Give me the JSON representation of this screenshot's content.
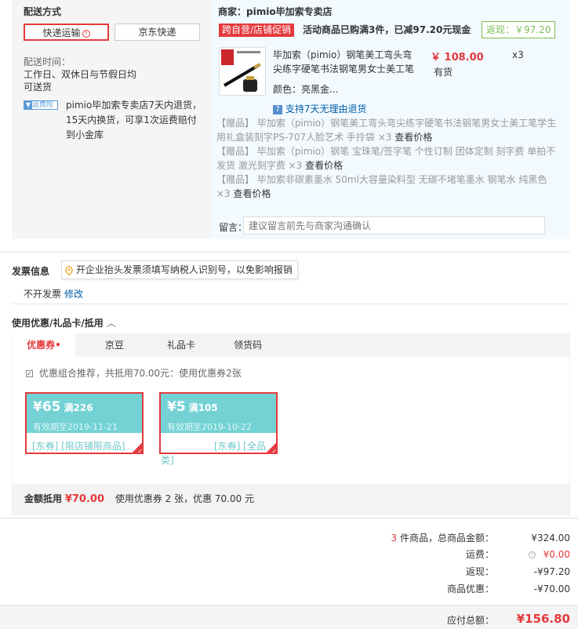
{
  "shipping": {
    "title": "配送方式",
    "option_express": "快递运输",
    "option_jd": "京东快递",
    "time_label": "配送时间：",
    "time_value": "工作日、双休日与节假日均",
    "time_value2": "可送货",
    "insurance_badge": "运费险",
    "insurance_l1": "pimio毕加索专卖店7天内退货，",
    "insurance_l2": "15天内换货，可享1次运费赔付",
    "insurance_l3": "到小金库"
  },
  "merchant": {
    "label": "商家：pimio毕加索专卖店",
    "promo_tag": "跨自营/店铺促销",
    "promo_text": "活动商品已购满3件，已减97.20元现金",
    "rebate": "返现：￥97.20"
  },
  "product": {
    "name_l1": "毕加索（pimio）钢笔美工弯头弯",
    "name_l2": "尖练字硬笔书法钢笔男女士美工笔",
    "price": "￥ 108.00",
    "qty": "x3",
    "stock": "有货",
    "color": "颜色：亮黑金...",
    "return_policy": "支持7天无理由退货"
  },
  "gifts": [
    {
      "l1": "【赠品】  毕加索（pimio）钢笔美工弯头弯尖练字硬笔书法钢笔男女士美工笔学生",
      "l2": "用礼盒装刻字PS-707人脸艺术 手拎袋 ×3",
      "link": "查看价格"
    },
    {
      "l1": "【赠品】  毕加索（pimio）钢笔 宝珠笔/签字笔 个性订制 团体定制 刻字费 单拍不",
      "l2": "发货 激光刻字费 ×3",
      "link": "查看价格"
    },
    {
      "l1": "【赠品】  毕加索非碳素墨水 50ml大容量染料型 无碳不堵笔墨水 钢笔水 纯黑色",
      "l2": "×3",
      "link": "查看价格"
    }
  ],
  "message": {
    "label": "留言：",
    "placeholder": "建议留言前先与商家沟通确认"
  },
  "invoice": {
    "title": "发票信息",
    "tip": "开企业抬头发票须填写纳税人识别号，以免影响报销",
    "value": "不开发票",
    "edit": "修改"
  },
  "coupons": {
    "section_title": "使用优惠/礼品卡/抵用",
    "tabs": [
      "优惠券•",
      "京豆",
      "礼品卡",
      "领货码"
    ],
    "combo_text": "优惠组合推荐，共抵用70.00元：使用优惠券2张",
    "items": [
      {
        "amount": "¥65",
        "cond": "满226",
        "valid": "有效期至2019-11-21",
        "scope": "[东券] [限店铺限商品]"
      },
      {
        "amount": "¥5",
        "cond": "满105",
        "valid": "有效期至2019-10-22",
        "scope1": "[东券] [全品",
        "scope2": "类]"
      }
    ],
    "summary_label": "金额抵用",
    "summary_amount": "¥70.00",
    "summary_text": "使用优惠券 2 张，优惠 70.00 元"
  },
  "totals": {
    "count": "3",
    "count_suffix": " 件商品，总商品金额：",
    "goods_total": "¥324.00",
    "freight_label": "运费：",
    "freight": "¥0.00",
    "rebate_label": "返现：",
    "rebate": "-¥97.20",
    "discount_label": "商品优惠：",
    "discount": "-¥70.00",
    "grand_label": "应付总额：",
    "grand": "¥156.80"
  },
  "colors": {
    "accent": "#e4393c",
    "coupon_teal": "#74d2d4",
    "rebate_green": "#7abd54",
    "link": "#005ea7"
  }
}
